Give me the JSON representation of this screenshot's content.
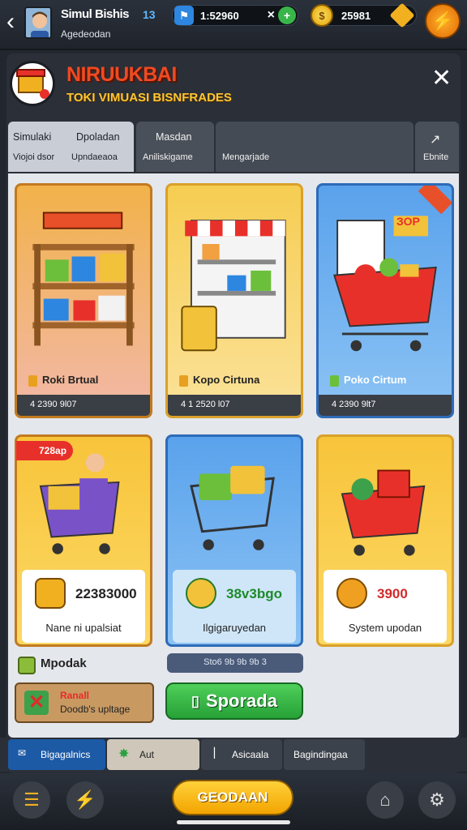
{
  "header": {
    "player_name": "Simul Bishis",
    "player_sub": "Agedeodan",
    "level": "13",
    "stat1_value": "1:52960",
    "stat1_mult": "×",
    "coins_value": "25981"
  },
  "panel": {
    "title": "NIRUUKBAI",
    "subtitle": "TOKI VIMUASI BISNFRADES"
  },
  "tabs": [
    {
      "line1": "Simulaki",
      "line1b": "Dpoladan",
      "line2": "Viojoi dsor",
      "line2b": "Upndaeaoa"
    },
    {
      "line1": "Masdan",
      "line2": "Aniliskigame"
    },
    {
      "line1": "",
      "line2": "Mengarjade"
    },
    {
      "line1": "",
      "line2": "Ebnite"
    }
  ],
  "cards_top": [
    {
      "name": "Roki Brtual",
      "price": "4 2390 9l07"
    },
    {
      "name": "Kopo Cirtuna",
      "price": "4 1 2520 l07"
    },
    {
      "name": "Poko Cirtum",
      "price": "4 2390 9lt7"
    }
  ],
  "cards_bottom": [
    {
      "ribbon": "728ap",
      "value": "22383000",
      "caption": "Nane ni upalsiat"
    },
    {
      "value": "38v3bgo",
      "caption": "Ilgigaruyedan"
    },
    {
      "value": "3900",
      "caption": "System upodan"
    }
  ],
  "badges": {
    "top_right_card3": "ЗОР"
  },
  "mpodak_label": "Mpodak",
  "card5_bar": "Sto6 9b 9b 9b 3",
  "upgrade_box": {
    "title": "Ranall",
    "desc": "Doodb's upltage"
  },
  "upgrade_button": "Sporada",
  "bottom_tabs": [
    "Bigagalnics",
    "Aut",
    "Asicaala",
    "Bagindingaa"
  ],
  "bottom_bar": {
    "main_button": "GEODAAN"
  },
  "colors": {
    "accent_orange": "#f04a22",
    "gold": "#ffc631",
    "green": "#27a137",
    "blue": "#1d5aa6"
  },
  "icons": [
    "back-icon",
    "flag-icon",
    "plus-icon",
    "coin-icon",
    "diamond-icon",
    "lightning-icon",
    "close-icon",
    "menu-icon",
    "boost-icon",
    "store-icon",
    "gear-icon"
  ]
}
